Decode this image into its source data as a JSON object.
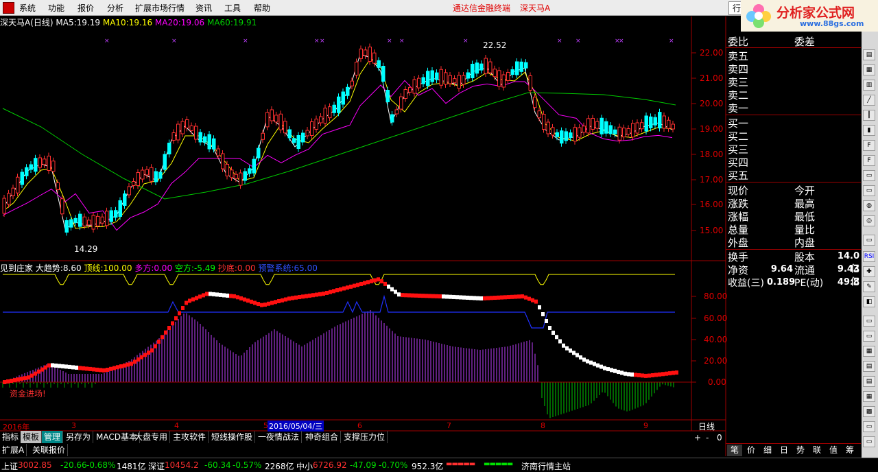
{
  "menu": [
    "系统",
    "功能",
    "报价",
    "分析",
    "扩展市场行情",
    "资讯",
    "工具",
    "帮助"
  ],
  "terminal_name": "通达信金融终端",
  "stock_name": "深天马A",
  "logo_text": "分析家公式网",
  "logo_url": "www.88gs.com",
  "hang_btn": "行",
  "chart_title": {
    "name": "深天马A",
    "period": "(日线)",
    "ma5_label": "MA5:",
    "ma5": "19.19",
    "ma10_label": "MA10:",
    "ma10": "19.16",
    "ma20_label": "MA20:",
    "ma20": "19.06",
    "ma60_label": "MA60:",
    "ma60": "19.91"
  },
  "price_axis": [
    "22.00",
    "21.00",
    "20.00",
    "19.00",
    "18.00",
    "17.00",
    "16.00",
    "15.00"
  ],
  "price_high_label": "22.52",
  "price_low_label": "14.29",
  "indicator_title": {
    "name": "见到庄家",
    "trend_label": "大趋势:",
    "trend": "8.60",
    "top_label": "顶线:",
    "top": "100.00",
    "long_label": "多方:",
    "long": "0.00",
    "short_label": "空方:",
    "short": "-5.49",
    "bottom_label": "抄底:",
    "bottom": "0.00",
    "warn_label": "预警系统:",
    "warn": "65.00"
  },
  "indicator_axis": [
    "80.00",
    "60.00",
    "40.00",
    "20.00",
    "0.00"
  ],
  "indicator_note": "资金进场!",
  "date_axis": {
    "year": "2016年",
    "m3": "3",
    "m4": "4",
    "m5": "5",
    "cursor": "2016/05/04/三",
    "m6": "6",
    "m7": "7",
    "m8": "8",
    "m9": "9",
    "period_btn": "日线"
  },
  "zoom_btns": [
    "+",
    "-",
    "0"
  ],
  "tabs": [
    "指标",
    "模板",
    "管理",
    "另存为",
    "MACD基本",
    "大盘专用",
    "主攻软件",
    "短线操作股",
    "一夜情战法",
    "神奇组合",
    "支撑压力位"
  ],
  "tabs2": [
    "扩展A",
    "关联报价"
  ],
  "quote": {
    "weibi": "委比",
    "weicha": "委差",
    "sell": [
      "卖五",
      "卖四",
      "卖三",
      "卖二",
      "卖一"
    ],
    "buy": [
      "买一",
      "买二",
      "买三",
      "买四",
      "买五"
    ],
    "rows": [
      [
        "现价",
        "今开"
      ],
      [
        "涨跌",
        "最高"
      ],
      [
        "涨幅",
        "最低"
      ],
      [
        "总量",
        "量比"
      ],
      [
        "外盘",
        "内盘"
      ]
    ],
    "turnover_label": "换手",
    "shares_label": "股本",
    "shares": "14.0亿",
    "netasset_label": "净资",
    "netasset": "9.64",
    "float_label": "流通",
    "float": "9.43亿",
    "eps_label": "收益(三)",
    "eps": "0.189",
    "pe_label": "PE(动)",
    "pe": "49.8"
  },
  "bottom_tabs": [
    "笔",
    "价",
    "细",
    "日",
    "势",
    "联",
    "值",
    "筹"
  ],
  "status": {
    "sh_label": "上证",
    "sh": "3002.85",
    "sh_chg": "-20.66",
    "sh_pct": "-0.68%",
    "sh_amt": "1481亿",
    "sz_label": "深证",
    "sz": "10454.2",
    "sz_chg": "-60.34",
    "sz_pct": "-0.57%",
    "sz_amt": "2268亿",
    "zx_label": "中小",
    "zx": "6726.92",
    "zx_chg": "-47.09",
    "zx_pct": "-0.70%",
    "zx_amt": "952.3亿",
    "station": "济南行情主站"
  },
  "colors": {
    "up": "#ff3030",
    "down": "#00ffff",
    "ma5": "#ffffff",
    "ma10": "#ffff00",
    "ma20": "#ff00ff",
    "ma60": "#00cc00",
    "axis": "#e00000"
  }
}
